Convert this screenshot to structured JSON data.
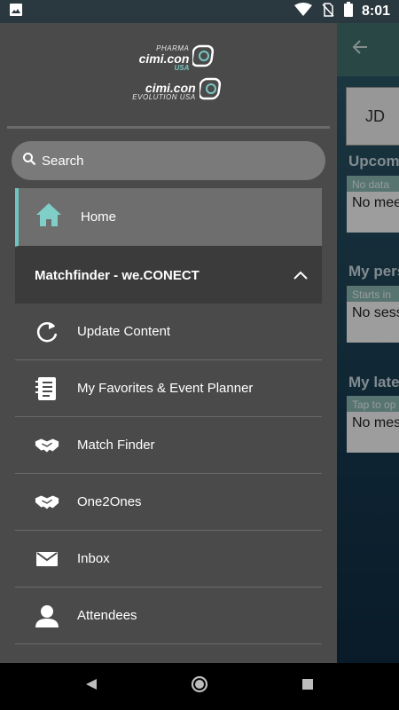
{
  "status_bar": {
    "time": "8:01",
    "icons": [
      "image-icon",
      "wifi-icon",
      "no-sim-icon",
      "battery-icon"
    ]
  },
  "drawer": {
    "logos": [
      {
        "top_text": "PHARMA",
        "main_text": "cimi.con",
        "bottom_text": "USA"
      },
      {
        "top_text": "",
        "main_text": "cimi.con",
        "bottom_text": "EVOLUTION USA"
      }
    ],
    "search": {
      "label": "Search",
      "icon": "search-icon"
    },
    "home": {
      "label": "Home",
      "icon": "home-icon"
    },
    "group": {
      "label": "Matchfinder - we.CONECT",
      "icon": "chevron-up-icon"
    },
    "items": [
      {
        "label": "Update Content",
        "icon": "refresh-icon"
      },
      {
        "label": "My Favorites & Event Planner",
        "icon": "planner-icon"
      },
      {
        "label": "Match Finder",
        "icon": "handshake-icon"
      },
      {
        "label": "One2Ones",
        "icon": "handshake-icon"
      },
      {
        "label": "Inbox",
        "icon": "mail-icon"
      },
      {
        "label": "Attendees",
        "icon": "person-icon"
      }
    ]
  },
  "background_app": {
    "avatar_initials": "JD",
    "sections": [
      {
        "title": "Upcom",
        "hint": "No data",
        "message": "No mee"
      },
      {
        "title": "My pers",
        "hint": "Starts in",
        "message": "No sess"
      },
      {
        "title": "My late",
        "hint": "Tap to op",
        "message": "No mes"
      }
    ]
  },
  "colors": {
    "accent": "#6ec5bf",
    "drawer_bg": "#4a4a4a",
    "home_bg": "#6e6e6e",
    "group_bg": "#3b3b3b"
  }
}
